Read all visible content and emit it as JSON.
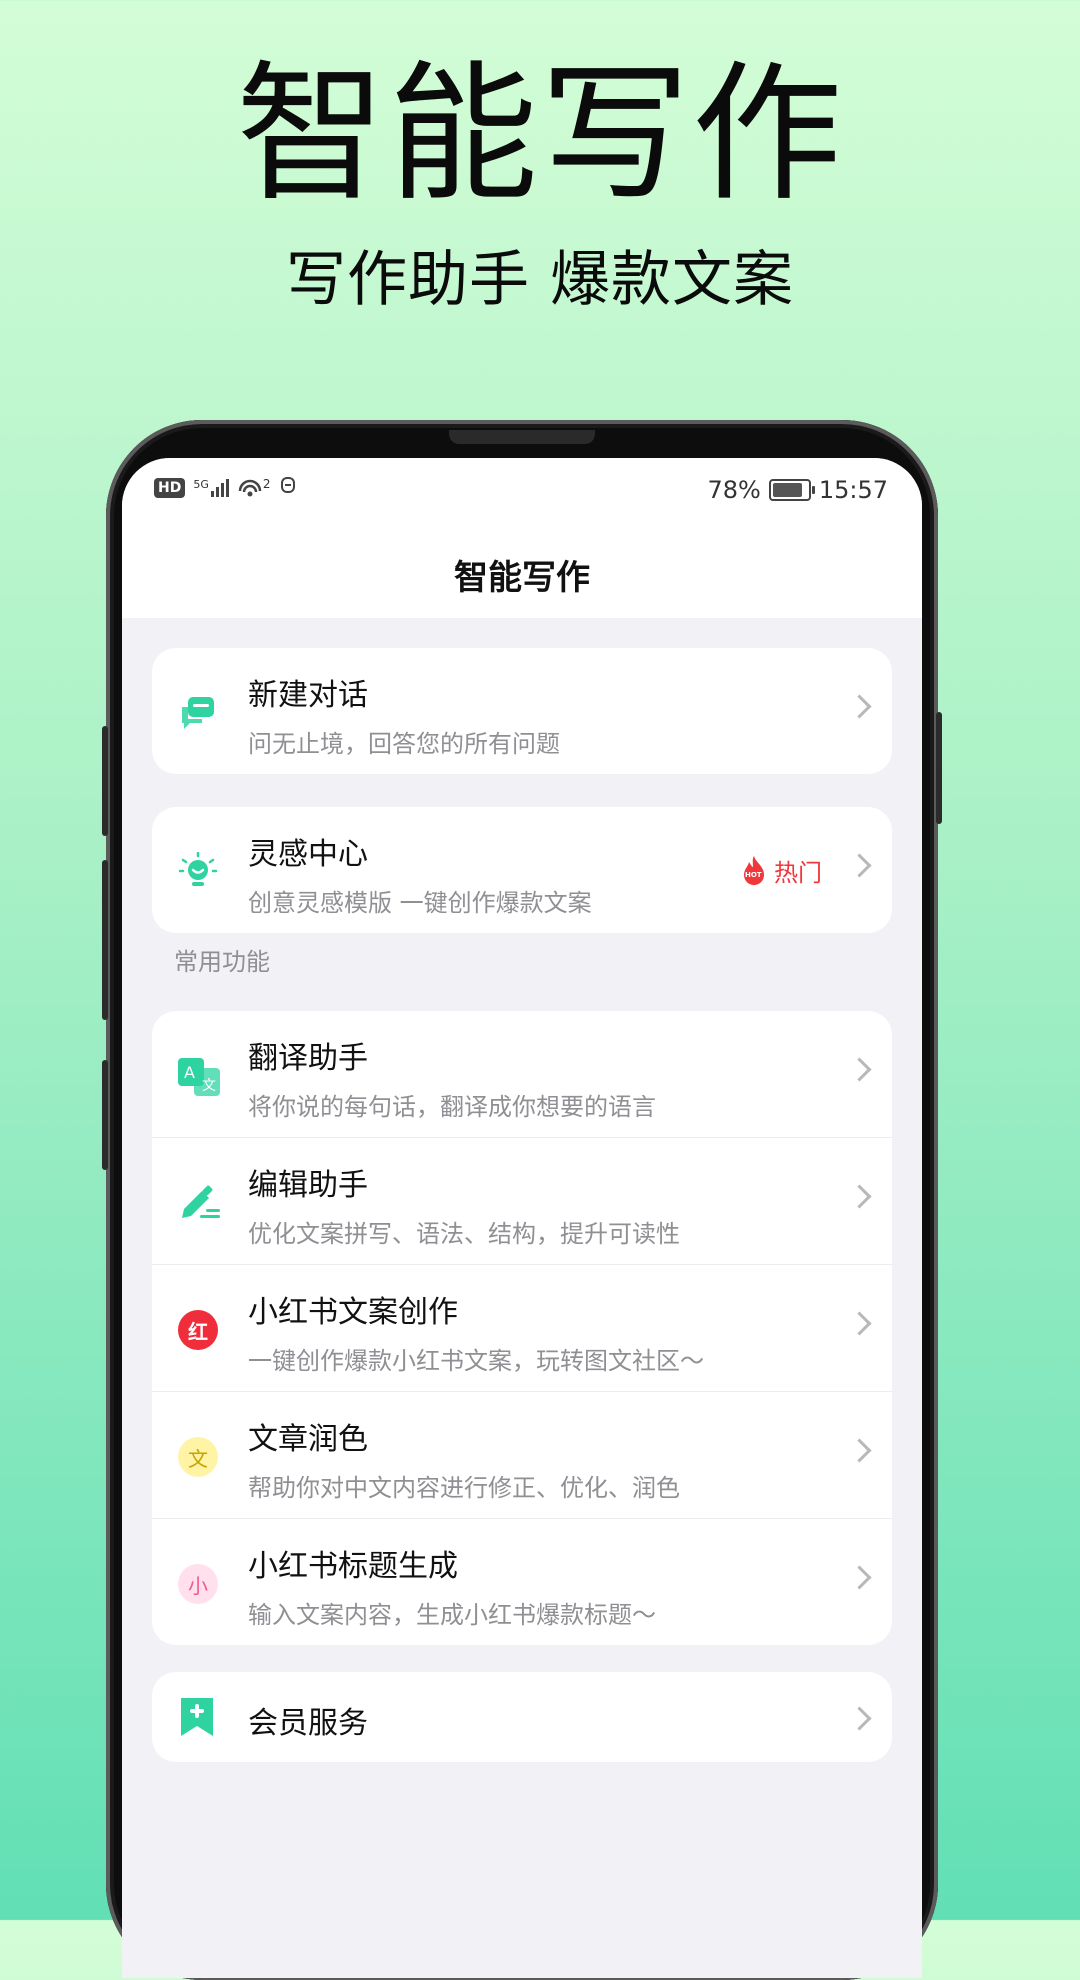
{
  "hero": {
    "title": "智能写作",
    "subtitle": "写作助手  爆款文案"
  },
  "status_bar": {
    "hd": "HD",
    "net_type": "5G",
    "wifi_num": "2",
    "battery_pct": "78%",
    "time": "15:57"
  },
  "page": {
    "title": "智能写作"
  },
  "cards": {
    "new_chat": {
      "title": "新建对话",
      "desc": "问无止境，回答您的所有问题",
      "icon": "chat-bubble-icon"
    },
    "inspiration": {
      "title": "灵感中心",
      "desc": "创意灵感模版  一键创作爆款文案",
      "icon": "lightbulb-icon",
      "badge": "热门",
      "badge_icon_text": "HOT"
    },
    "section_label": "常用功能",
    "functions": [
      {
        "title": "翻译助手",
        "desc": "将你说的每句话，翻译成你想要的语言",
        "icon": "translate-icon"
      },
      {
        "title": "编辑助手",
        "desc": "优化文案拼写、语法、结构，提升可读性",
        "icon": "edit-pen-icon"
      },
      {
        "title": "小红书文案创作",
        "desc": "一键创作爆款小红书文案，玩转图文社区～",
        "icon": "red-book-icon",
        "icon_text": "红"
      },
      {
        "title": "文章润色",
        "desc": "帮助你对中文内容进行修正、优化、润色",
        "icon": "text-polish-icon",
        "icon_text": "文"
      },
      {
        "title": "小红书标题生成",
        "desc": "输入文案内容，生成小红书爆款标题～",
        "icon": "title-gen-icon",
        "icon_text": "小"
      }
    ],
    "membership": {
      "title": "会员服务",
      "icon": "bookmark-plus-icon"
    }
  },
  "colors": {
    "accent": "#2ed3a0",
    "hot": "#f0373b",
    "red_book": "#f02d3a",
    "polish_bg": "#fff4a6",
    "polish_fg": "#c9a100",
    "title_bg": "#ffe0ec",
    "title_fg": "#f05a8a"
  }
}
